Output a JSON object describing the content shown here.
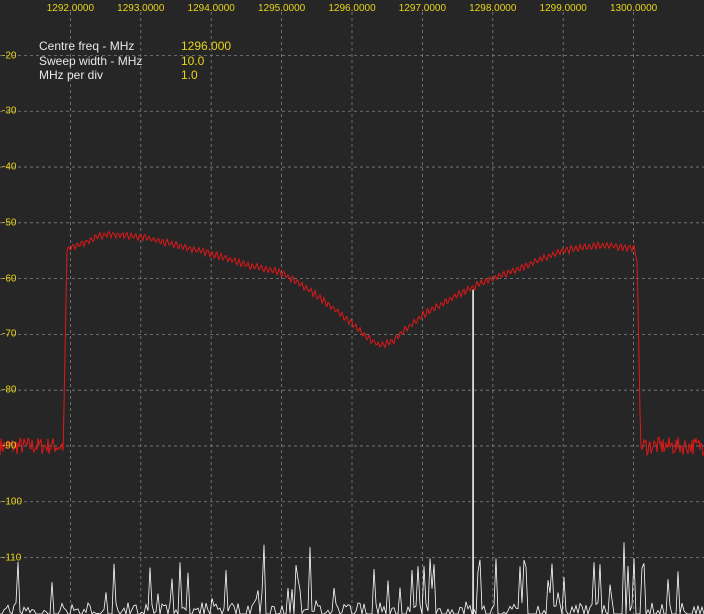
{
  "display": {
    "background": "#262626",
    "grid_color": "#808080",
    "label_color": "#e8d51a",
    "trace_color": "#e01818",
    "live_color": "#ffffff"
  },
  "info": {
    "centre_label": "Centre freq - MHz",
    "centre_value": "1296.000",
    "sweep_label": "Sweep width - MHz",
    "sweep_value": "10.0",
    "perdiv_label": "MHz per div",
    "perdiv_value": "1.0"
  },
  "chart_data": {
    "type": "line",
    "xlim": [
      1291.0,
      1301.0
    ],
    "ylim": [
      -120,
      -10
    ],
    "grid": true,
    "x_ticks": [
      "1292.0000",
      "1293.0000",
      "1294.0000",
      "1295.0000",
      "1296.0000",
      "1297.0000",
      "1298.0000",
      "1299.0000",
      "1300.0000"
    ],
    "y_ticks": [
      "-20",
      "-30",
      "-40",
      "-50",
      "-60",
      "-70",
      "-80",
      "-90",
      "-100",
      "-110"
    ],
    "series": [
      {
        "x": [
          1291.0,
          1291.9,
          1291.95,
          1292.0,
          1292.5,
          1293.0,
          1293.5,
          1294.0,
          1294.5,
          1295.0,
          1295.2,
          1295.5,
          1296.0,
          1296.2,
          1296.4,
          1296.6,
          1297.0,
          1297.5,
          1297.8,
          1298.0,
          1298.5,
          1299.0,
          1299.5,
          1300.0,
          1300.05,
          1300.1,
          1301.0
        ],
        "y": [
          -90,
          -90,
          -55,
          -54.5,
          -52,
          -52.5,
          -54,
          -55.5,
          -57.5,
          -59,
          -60.5,
          -63,
          -68,
          -70.5,
          -72,
          -71,
          -66.5,
          -63,
          -61,
          -60,
          -57.5,
          -55,
          -54,
          -54.5,
          -56.5,
          -90,
          -90
        ]
      },
      {
        "x": [
          1297.7,
          1297.72,
          1297.74
        ],
        "y": [
          -120,
          -62,
          -120
        ]
      }
    ]
  }
}
